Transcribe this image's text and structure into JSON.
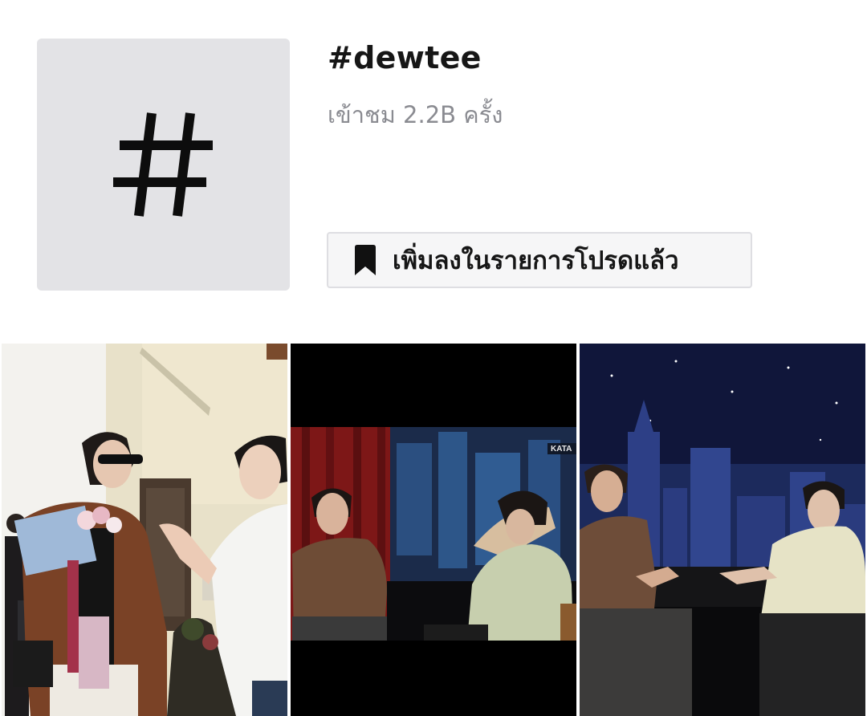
{
  "hashtag": {
    "symbol": "#",
    "title": "#dewtee",
    "views": "เข้าชม 2.2B ครั้ง"
  },
  "favorite_button": {
    "label": "เพิ่มลงในรายการโปรดแล้ว",
    "icon": "bookmark-icon"
  },
  "videos": [
    {
      "id": "video-1",
      "scene": "outdoor-bouquet"
    },
    {
      "id": "video-2",
      "scene": "talk-show-studio"
    },
    {
      "id": "video-3",
      "scene": "talk-show-city-backdrop"
    }
  ],
  "colors": {
    "tile_bg": "#e3e3e6",
    "title": "#161616",
    "muted_text": "#8a8b91",
    "button_bg": "#f6f6f7",
    "button_border": "#dedee2"
  }
}
